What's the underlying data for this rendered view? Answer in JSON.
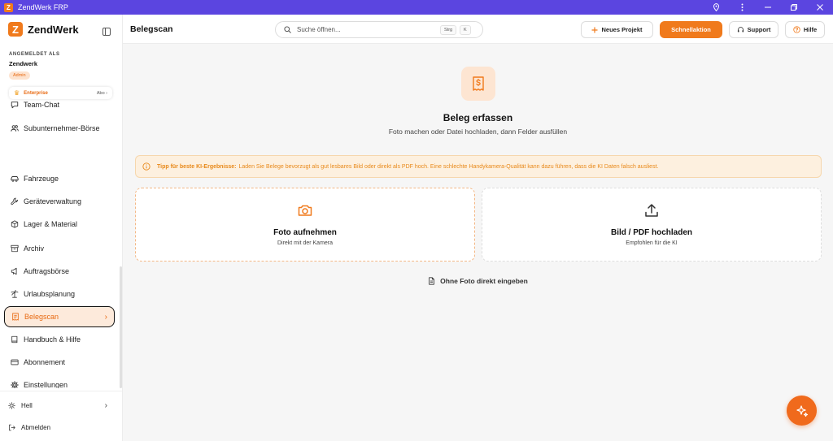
{
  "window": {
    "title": "ZendWerk FRP"
  },
  "sidebar": {
    "brand": "ZendWerk",
    "logged_in_label": "ANGEMELDET ALS",
    "user_name": "Zendwerk",
    "role_badge": "Admin",
    "plan": {
      "name": "Enterprise",
      "link": "Abo ›"
    },
    "items": [
      {
        "label": "Team-Chat",
        "icon": "chat-icon"
      },
      {
        "label": "Subunternehmer-Börse",
        "icon": "users-icon"
      },
      {
        "label": "Fahrzeuge",
        "icon": "car-icon"
      },
      {
        "label": "Geräteverwaltung",
        "icon": "wrench-icon"
      },
      {
        "label": "Lager & Material",
        "icon": "package-icon"
      },
      {
        "label": "Archiv",
        "icon": "archive-icon"
      },
      {
        "label": "Auftragsbörse",
        "icon": "megaphone-icon"
      },
      {
        "label": "Urlaubsplanung",
        "icon": "palm-tree-icon"
      },
      {
        "label": "Belegscan",
        "icon": "receipt-icon",
        "active": true
      },
      {
        "label": "Handbuch & Hilfe",
        "icon": "book-icon"
      },
      {
        "label": "Abonnement",
        "icon": "credit-card-icon"
      },
      {
        "label": "Einstellungen",
        "icon": "gear-icon"
      }
    ],
    "theme_label": "Hell",
    "logout_label": "Abmelden"
  },
  "header": {
    "title": "Belegscan",
    "search_placeholder": "Suche öffnen...",
    "shortcut_keys": [
      "Strg",
      "K"
    ],
    "new_project": "Neues Projekt",
    "quick_action": "Schnellaktion",
    "support": "Support",
    "help": "Hilfe"
  },
  "main": {
    "title": "Beleg erfassen",
    "subtitle": "Foto machen oder Datei hochladen, dann Felder ausfüllen",
    "tip_bold": "Tipp für beste KI-Ergebnisse:",
    "tip_text": "Laden Sie Belege bevorzugt als gut lesbares Bild oder direkt als PDF hoch. Eine schlechte Handykamera-Qualität kann dazu führen, dass die KI Daten falsch ausliest.",
    "cards": [
      {
        "title": "Foto aufnehmen",
        "subtitle": "Direkt mit der Kamera",
        "icon": "camera-icon"
      },
      {
        "title": "Bild / PDF hochladen",
        "subtitle": "Empfohlen für die KI",
        "icon": "upload-icon"
      }
    ],
    "manual_entry": "Ohne Foto direkt eingeben"
  },
  "colors": {
    "accent": "#f07a1c",
    "titlebar": "#5b45e0",
    "active_bg": "#fdeadb",
    "tip_bg": "#fdf0df"
  }
}
